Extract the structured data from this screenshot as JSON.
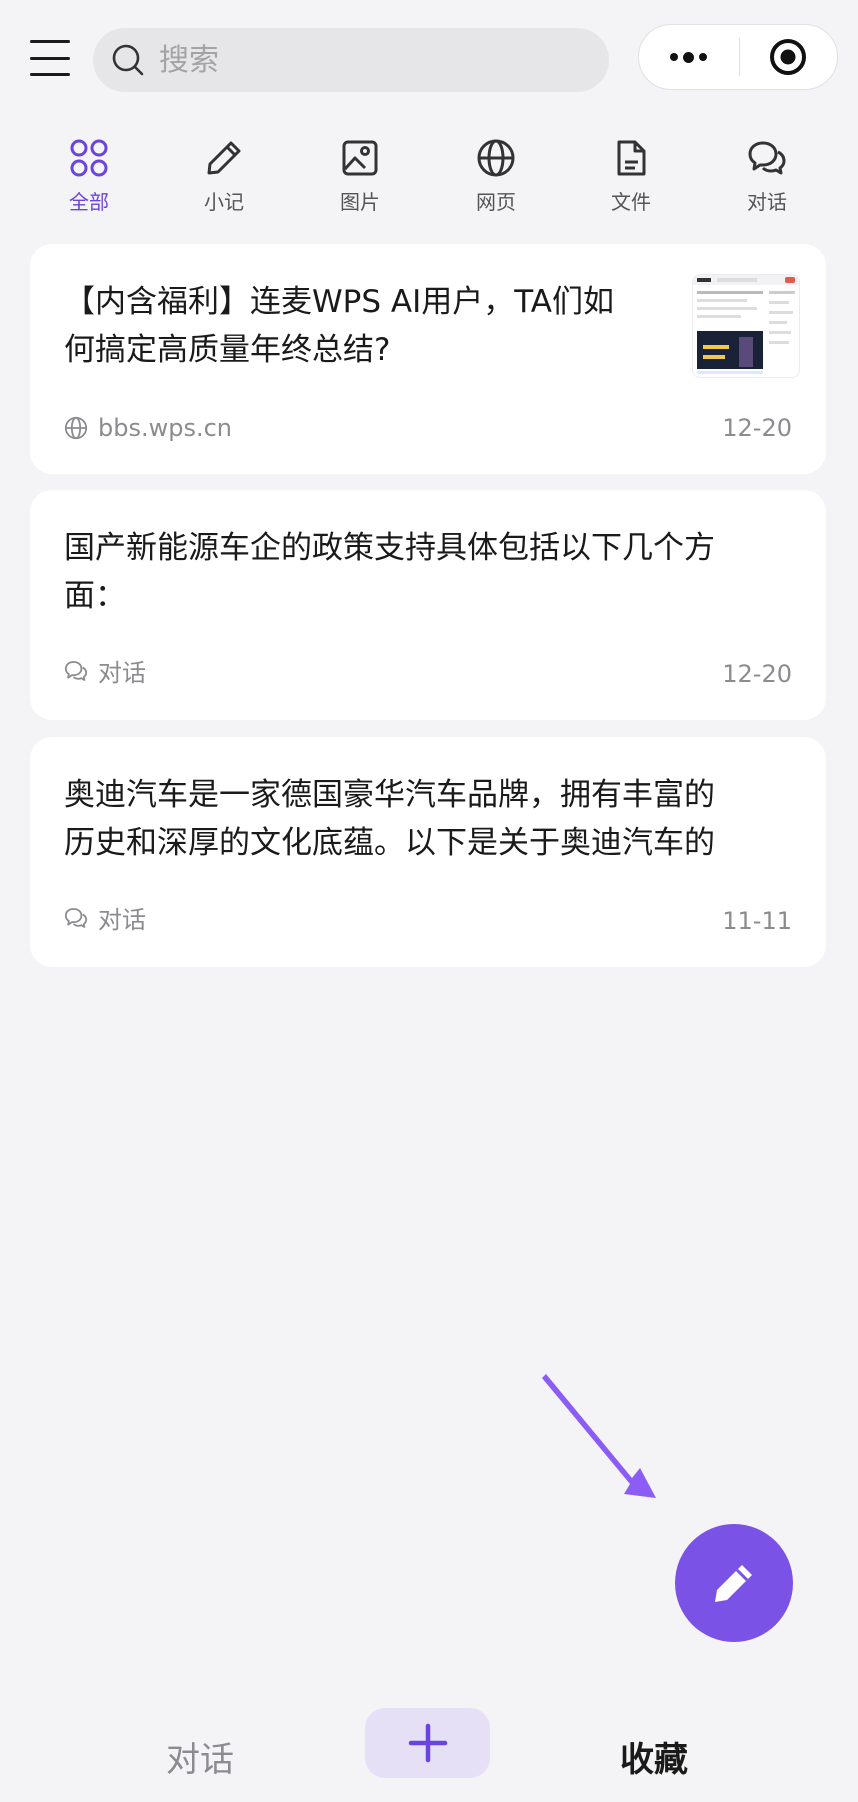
{
  "search": {
    "placeholder": "搜索"
  },
  "tabs": [
    {
      "label": "全部",
      "icon": "grid-icon",
      "active": true
    },
    {
      "label": "小记",
      "icon": "pencil-icon",
      "active": false
    },
    {
      "label": "图片",
      "icon": "image-icon",
      "active": false
    },
    {
      "label": "网页",
      "icon": "globe-icon",
      "active": false
    },
    {
      "label": "文件",
      "icon": "document-icon",
      "active": false
    },
    {
      "label": "对话",
      "icon": "chat-icon",
      "active": false
    }
  ],
  "cards": [
    {
      "title_line1": "【内含福利】连麦WPS AI用户，TA们如",
      "title_line2": "何搞定高质量年终总结?",
      "source": "bbs.wps.cn",
      "source_icon": "globe-icon",
      "date": "12-20"
    },
    {
      "title_line1": "国产新能源车企的政策支持具体包括以下几个方",
      "title_line2": "面：",
      "source": "对话",
      "source_icon": "chat-icon",
      "date": "12-20"
    },
    {
      "title_line1": "奥迪汽车是一家德国豪华汽车品牌，拥有丰富的",
      "title_line2": "历史和深厚的文化底蕴。以下是关于奥迪汽车的",
      "source": "对话",
      "source_icon": "chat-icon",
      "date": "11-11"
    }
  ],
  "bottom_bar": {
    "left_label": "对话",
    "right_label": "收藏",
    "add_icon": "plus-icon"
  },
  "colors": {
    "accent": "#7b52e6",
    "accent_text": "#6a44e0",
    "background": "#f4f4f6",
    "muted_text": "#8c8c90"
  }
}
